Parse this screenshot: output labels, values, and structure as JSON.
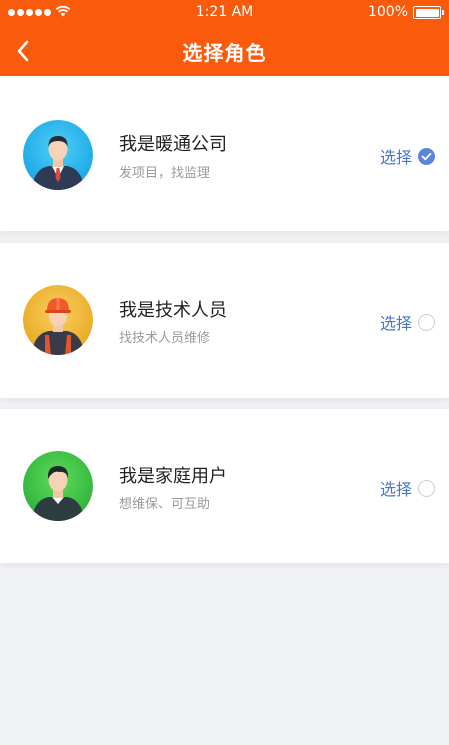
{
  "status_bar": {
    "time": "1:21 AM",
    "battery": "100%",
    "signal_icon": "signal-dots-icon",
    "wifi_icon": "wifi-icon",
    "battery_icon": "battery-icon"
  },
  "header": {
    "title": "选择角色",
    "back_icon": "back-arrow-icon",
    "background_color": "#fa5a0c"
  },
  "roles": [
    {
      "name": "我是暖通公司",
      "description": "发项目，找监理",
      "choose_label": "选择",
      "selected": true,
      "avatar": "businessman-avatar-icon",
      "avatar_color": "#27b7ee"
    },
    {
      "name": "我是技术人员",
      "description": "找技术人员维修",
      "choose_label": "选择",
      "selected": false,
      "avatar": "technician-avatar-icon",
      "avatar_color": "#f2b630"
    },
    {
      "name": "我是家庭用户",
      "description": "想维保、可互助",
      "choose_label": "选择",
      "selected": false,
      "avatar": "home-user-avatar-icon",
      "avatar_color": "#3cc04a"
    }
  ],
  "colors": {
    "accent": "#4a76c8",
    "check": "#5b86d8",
    "background": "#eff1f4"
  }
}
